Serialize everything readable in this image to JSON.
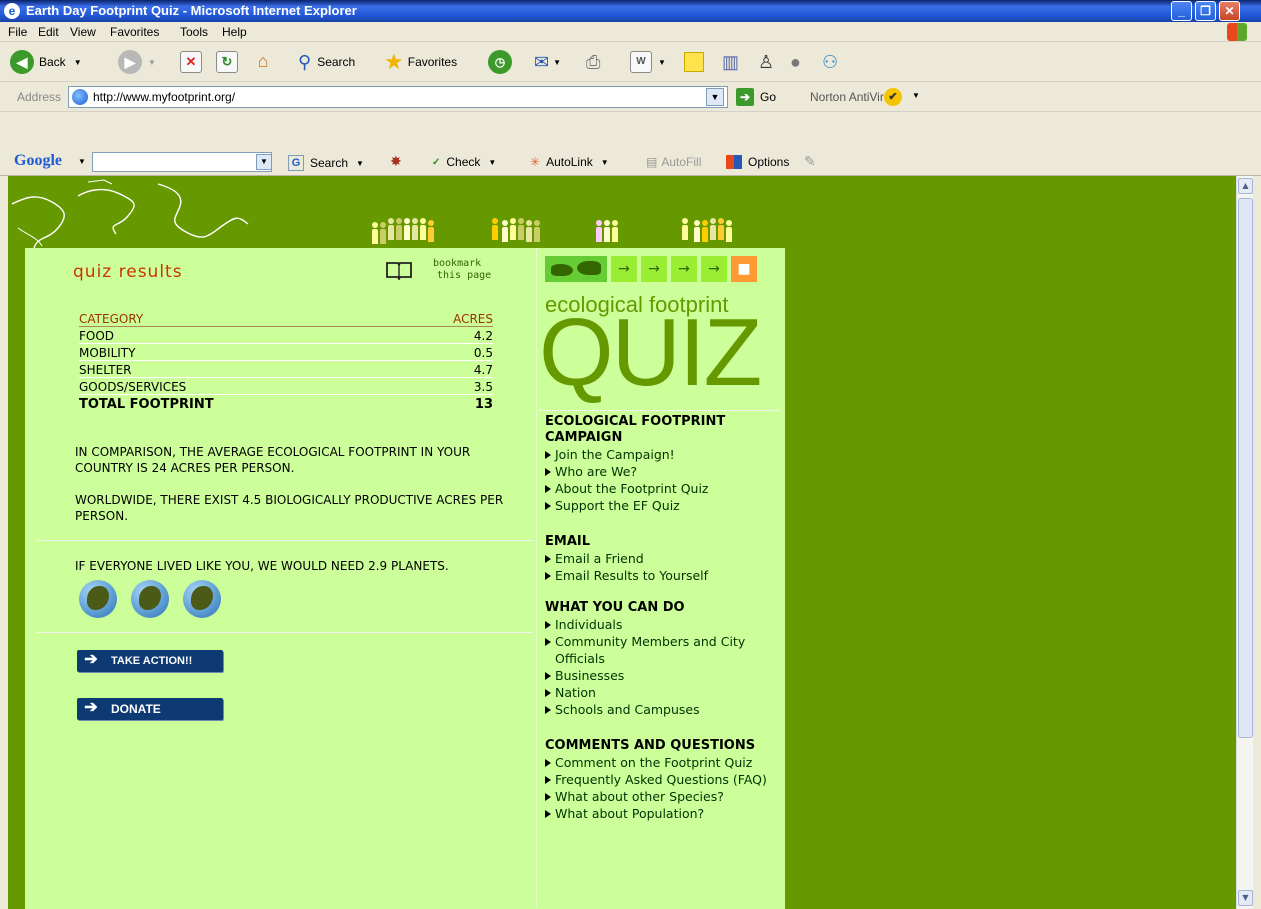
{
  "window": {
    "title": "Earth Day Footprint Quiz - Microsoft Internet Explorer",
    "minimize": "_",
    "restore": "❐",
    "close": "✕"
  },
  "menu": [
    "File",
    "Edit",
    "View",
    "Favorites",
    "Tools",
    "Help"
  ],
  "toolbar": {
    "back": "Back",
    "search": "Search",
    "favorites": "Favorites"
  },
  "address": {
    "label": "Address",
    "url": "http://www.myfootprint.org/",
    "go": "Go",
    "norton": "Norton AntiVirus"
  },
  "googlebar": {
    "logo": "Google",
    "search": "Search",
    "check": "Check",
    "autolink": "AutoLink",
    "autofill": "AutoFill",
    "options": "Options"
  },
  "page": {
    "quiz_results_title": "quiz results",
    "bookmark_line1": "bookmark",
    "bookmark_line2": "this page",
    "table": {
      "col_category": "CATEGORY",
      "col_acres": "ACRES",
      "rows": [
        {
          "category": "FOOD",
          "acres": "4.2"
        },
        {
          "category": "MOBILITY",
          "acres": "0.5"
        },
        {
          "category": "SHELTER",
          "acres": "4.7"
        },
        {
          "category": "GOODS/SERVICES",
          "acres": "3.5"
        }
      ],
      "total_label": "TOTAL FOOTPRINT",
      "total_value": "13"
    },
    "comparison_text": "IN COMPARISON, THE AVERAGE ECOLOGICAL FOOTPRINT IN YOUR COUNTRY IS 24 ACRES PER PERSON.",
    "worldwide_text": "WORLDWIDE, THERE EXIST 4.5 BIOLOGICALLY PRODUCTIVE ACRES PER PERSON.",
    "planets_text": "IF EVERYONE LIVED LIKE YOU, WE WOULD NEED 2.9 PLANETS.",
    "take_action": "TAKE ACTION!!",
    "donate": "DONATE",
    "nav_arrow": "→",
    "nav_current": "■",
    "ef_title": "ecological footprint",
    "quiz_big": "QUIZ",
    "sections": [
      {
        "title": "ECOLOGICAL FOOTPRINT CAMPAIGN",
        "links": [
          "Join the Campaign!",
          "Who are We?",
          "About the Footprint Quiz",
          "Support the EF Quiz"
        ]
      },
      {
        "title": "EMAIL",
        "links": [
          "Email a Friend",
          "Email Results to Yourself"
        ]
      },
      {
        "title": "WHAT YOU CAN DO",
        "links": [
          "Individuals",
          "Community Members and City Officials",
          "Businesses",
          "Nation",
          "Schools and Campuses"
        ]
      },
      {
        "title": "COMMENTS AND QUESTIONS",
        "links": [
          "Comment on the Footprint Quiz",
          "Frequently Asked Questions (FAQ)",
          "What about other Species?",
          "What about Population?"
        ]
      }
    ]
  },
  "colors": {
    "page_bg": "#669900",
    "panel_bg": "#ccff99",
    "title_red": "#cc3300",
    "button_navy": "#0d3a73",
    "nav_current": "#ff9933"
  }
}
